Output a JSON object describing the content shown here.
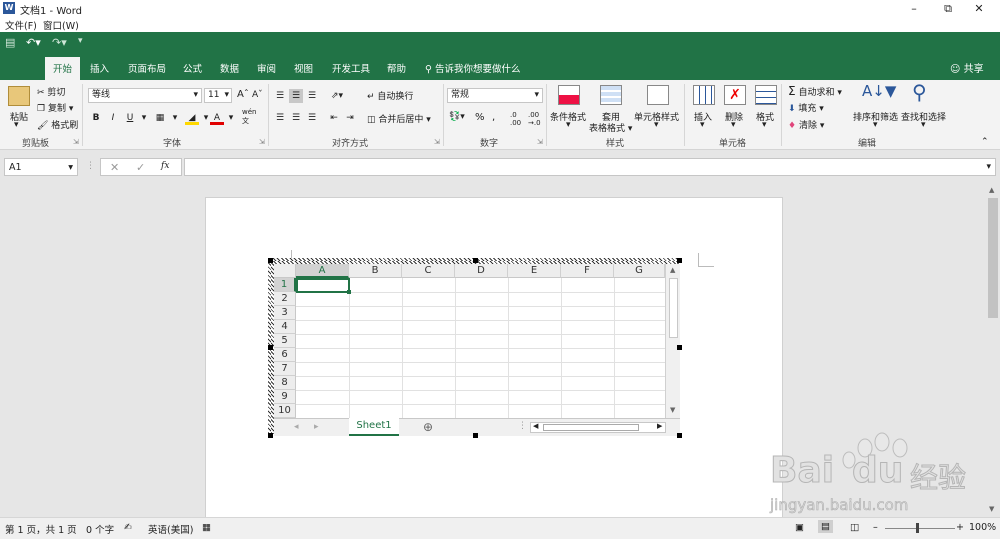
{
  "titlebar": {
    "title": "文档1 - Word",
    "app_icon": "W"
  },
  "menu": {
    "file": "文件(F)",
    "window": "窗口(W)"
  },
  "tabs": [
    {
      "label": "开始",
      "active": true
    },
    {
      "label": "插入"
    },
    {
      "label": "页面布局"
    },
    {
      "label": "公式"
    },
    {
      "label": "数据"
    },
    {
      "label": "审阅"
    },
    {
      "label": "视图"
    },
    {
      "label": "开发工具"
    },
    {
      "label": "帮助"
    }
  ],
  "tellme": "告诉我你想要做什么",
  "share": "共享",
  "ribbon": {
    "clipboard": {
      "paste": "粘贴",
      "cut": "剪切",
      "copy": "复制",
      "painter": "格式刷",
      "label": "剪贴板"
    },
    "font": {
      "name": "等线",
      "size": "11",
      "label": "字体"
    },
    "alignment": {
      "wrap": "自动换行",
      "merge": "合并后居中",
      "label": "对齐方式"
    },
    "number": {
      "format": "常规",
      "label": "数字"
    },
    "styles": {
      "cond": "条件格式",
      "table_fmt_1": "套用",
      "table_fmt_2": "表格格式",
      "cell_styles": "单元格样式",
      "label": "样式"
    },
    "cells": {
      "insert": "插入",
      "delete": "删除",
      "format": "格式",
      "label": "单元格"
    },
    "editing": {
      "autosum": "自动求和",
      "fill": "填充",
      "clear": "清除",
      "sort": "排序和筛选",
      "find": "查找和选择",
      "label": "编辑"
    }
  },
  "formula": {
    "namebox": "A1",
    "fx": "fx"
  },
  "sheet": {
    "columns": [
      "A",
      "B",
      "C",
      "D",
      "E",
      "F",
      "G"
    ],
    "rows": [
      "1",
      "2",
      "3",
      "4",
      "5",
      "6",
      "7",
      "8",
      "9",
      "10"
    ],
    "tab": "Sheet1"
  },
  "status": {
    "page": "第 1 页，共 1 页",
    "words": "0 个字",
    "lang": "英语(美国)",
    "zoom": "100%"
  },
  "watermark": {
    "brand": "Bai",
    "brand2": "du",
    "cn": "经验",
    "url": "jingyan.baidu.com"
  },
  "colors": {
    "green": "#217346",
    "selection": "#217346"
  }
}
